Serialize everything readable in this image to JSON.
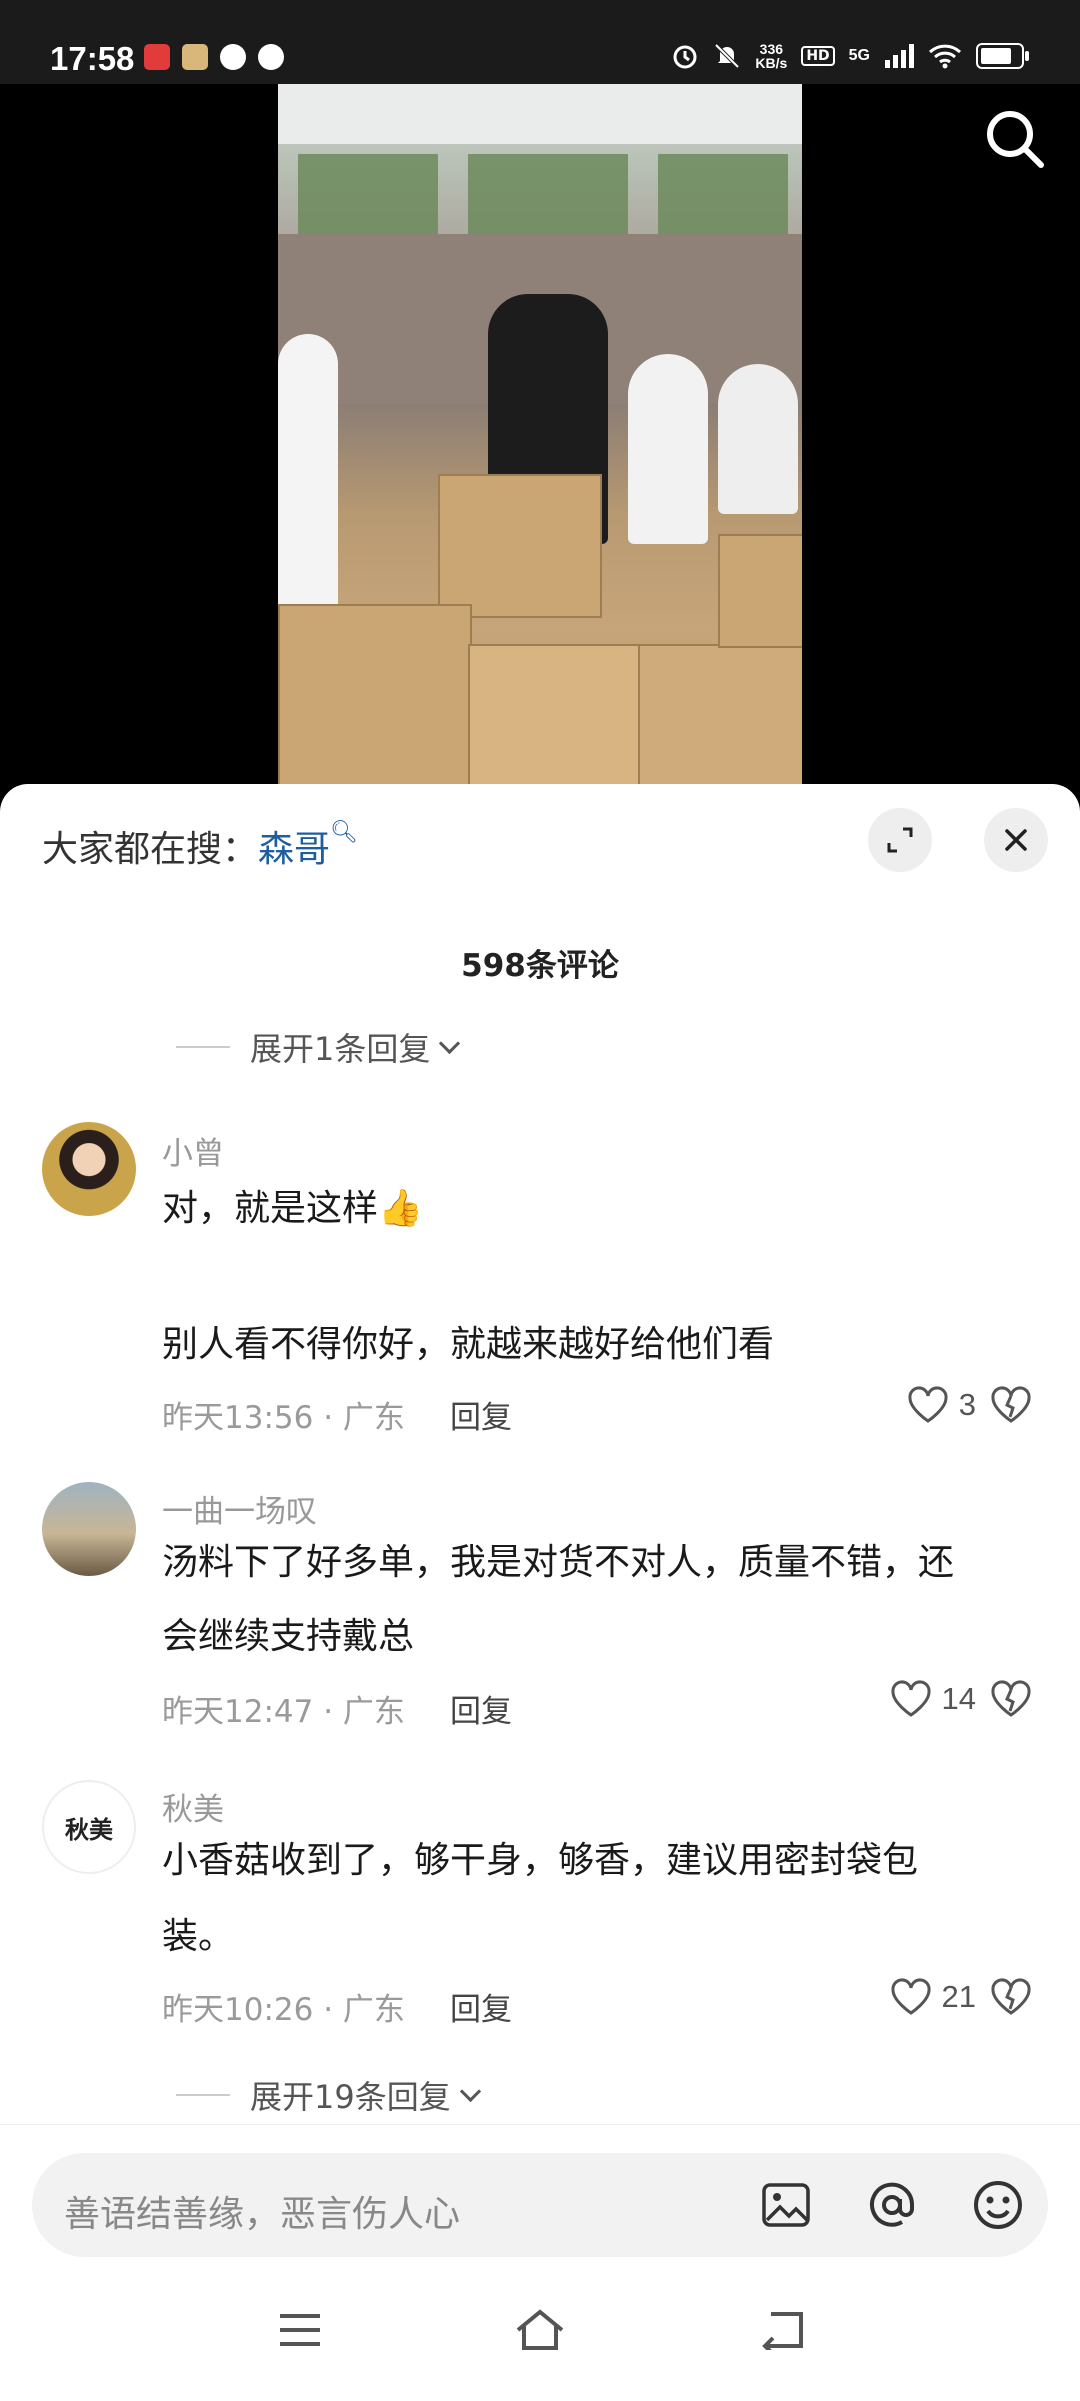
{
  "status_bar": {
    "time": "17:58",
    "net_speed_value": "336",
    "net_speed_unit": "KB/s",
    "hd_label": "HD",
    "network_label": "5G"
  },
  "search_hint": {
    "prefix": "大家都在搜：",
    "keyword": "森哥"
  },
  "comments_count": "598条评论",
  "expand_top": "展开1条回复",
  "comments": [
    {
      "name": "小曾",
      "line1": "对，就是这样👍",
      "line2": "别人看不得你好，就越来越好给他们看",
      "time_loc": "昨天13:56 · 广东",
      "reply": "回复",
      "likes": "3"
    },
    {
      "name": "一曲一场叹",
      "line1": "汤料下了好多单，我是对货不对人，质量不错，还",
      "line2": "会继续支持戴总",
      "time_loc": "昨天12:47 · 广东",
      "reply": "回复",
      "likes": "14"
    },
    {
      "name": "秋美",
      "avatar_text": "秋美",
      "line1": "小香菇收到了，够干身，够香，建议用密封袋包",
      "line2": "装。",
      "time_loc": "昨天10:26 · 广东",
      "reply": "回复",
      "likes": "21"
    }
  ],
  "expand_bottom": "展开19条回复",
  "input": {
    "placeholder": "善语结善缘，恶言伤人心"
  },
  "icons": [
    "search-icon",
    "expand-icon",
    "close-icon",
    "heart-icon",
    "broken-heart-icon",
    "image-icon",
    "at-icon",
    "emoji-icon",
    "menu-icon",
    "home-icon",
    "back-icon"
  ]
}
